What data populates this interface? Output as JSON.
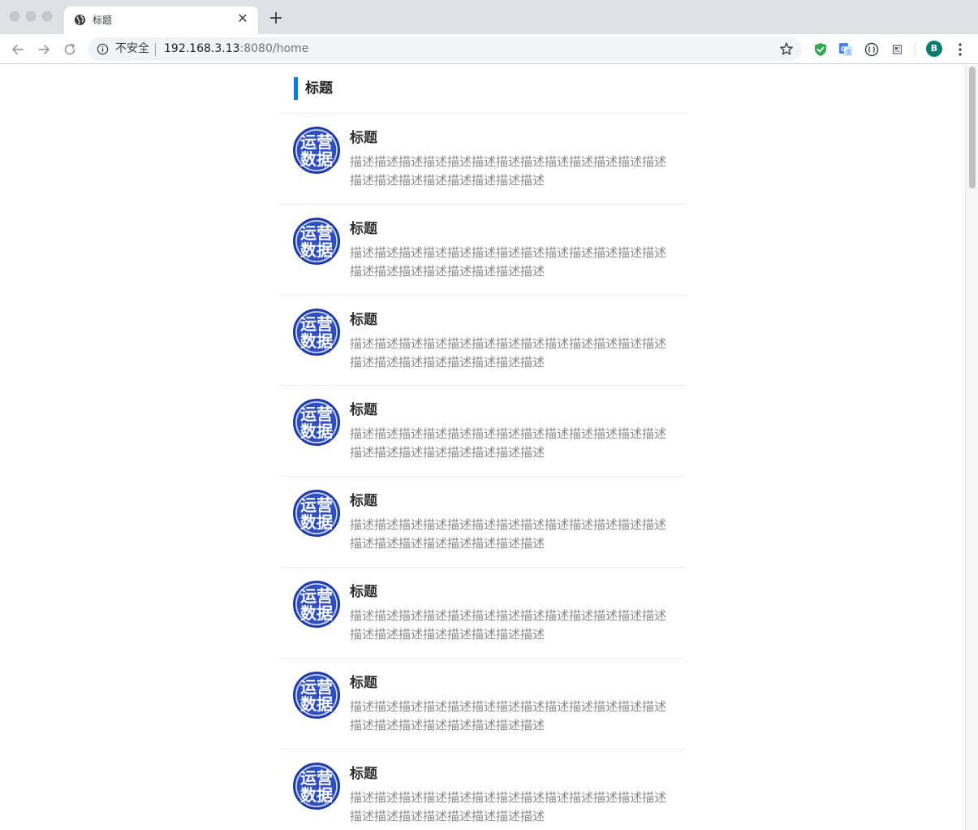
{
  "browser": {
    "tab_title": "标题",
    "security_label": "不安全",
    "url_host": "192.168.3.13",
    "url_rest": ":8080/home",
    "profile_initial": "B",
    "accent_color": "#1976d2"
  },
  "page": {
    "section_title": "标题",
    "items": [
      {
        "logo_text_line1": "运营",
        "logo_text_line2": "数据",
        "title": "标题",
        "description": "描述描述描述描述描述描述描述描述描述描述描述描述描述描述描述描述描述描述描述描述描述"
      },
      {
        "logo_text_line1": "运营",
        "logo_text_line2": "数据",
        "title": "标题",
        "description": "描述描述描述描述描述描述描述描述描述描述描述描述描述描述描述描述描述描述描述描述描述"
      },
      {
        "logo_text_line1": "运营",
        "logo_text_line2": "数据",
        "title": "标题",
        "description": "描述描述描述描述描述描述描述描述描述描述描述描述描述描述描述描述描述描述描述描述描述"
      },
      {
        "logo_text_line1": "运营",
        "logo_text_line2": "数据",
        "title": "标题",
        "description": "描述描述描述描述描述描述描述描述描述描述描述描述描述描述描述描述描述描述描述描述描述"
      },
      {
        "logo_text_line1": "运营",
        "logo_text_line2": "数据",
        "title": "标题",
        "description": "描述描述描述描述描述描述描述描述描述描述描述描述描述描述描述描述描述描述描述描述描述"
      },
      {
        "logo_text_line1": "运营",
        "logo_text_line2": "数据",
        "title": "标题",
        "description": "描述描述描述描述描述描述描述描述描述描述描述描述描述描述描述描述描述描述描述描述描述"
      },
      {
        "logo_text_line1": "运营",
        "logo_text_line2": "数据",
        "title": "标题",
        "description": "描述描述描述描述描述描述描述描述描述描述描述描述描述描述描述描述描述描述描述描述描述"
      },
      {
        "logo_text_line1": "运营",
        "logo_text_line2": "数据",
        "title": "标题",
        "description": "描述描述描述描述描述描述描述描述描述描述描述描述描述描述描述描述描述描述描述描述描述"
      }
    ]
  }
}
